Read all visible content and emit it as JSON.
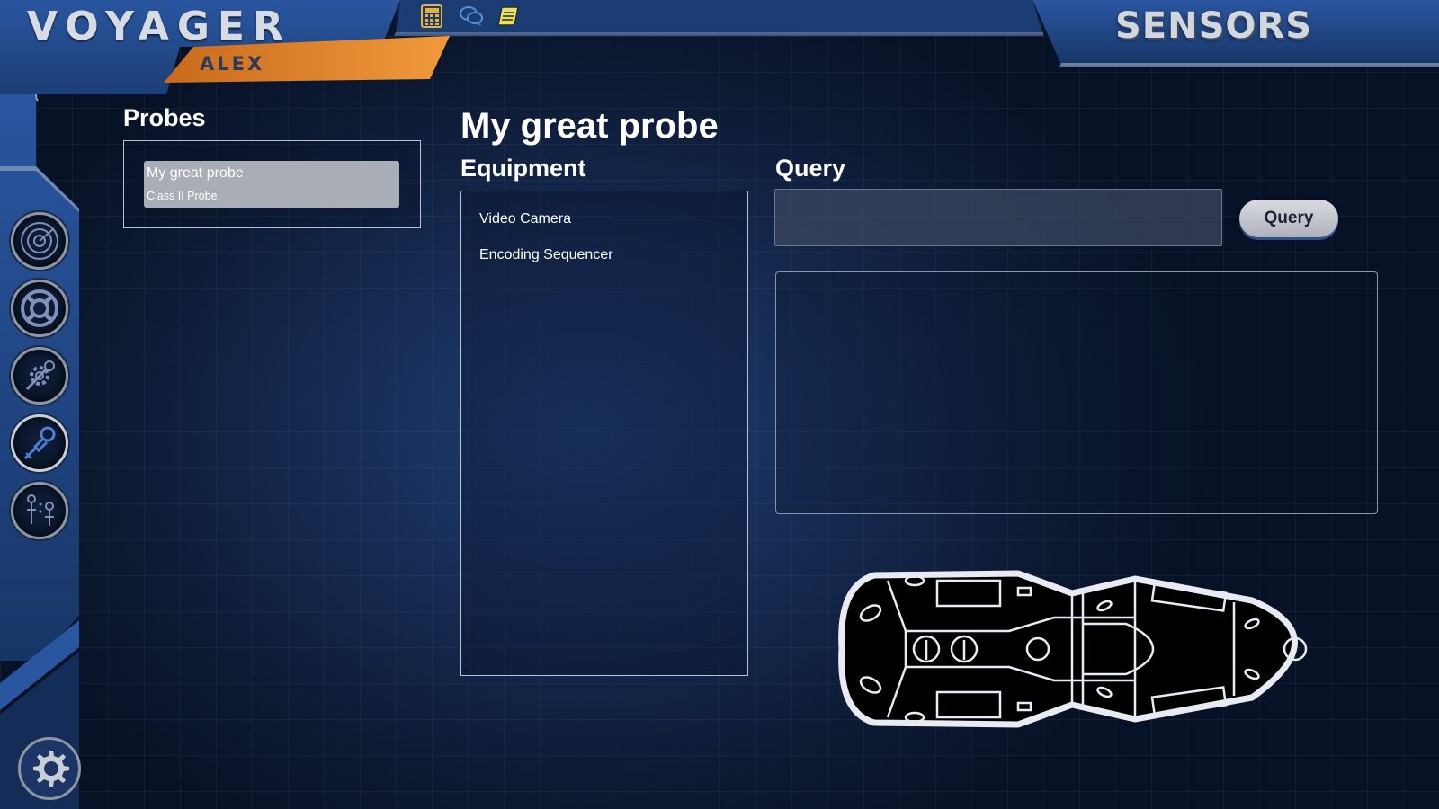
{
  "header": {
    "app_title": "VOYAGER",
    "user_name": "ALEX",
    "station_title": "SENSORS",
    "top_icons": [
      {
        "name": "calculator-icon",
        "color": "#e8b23a"
      },
      {
        "name": "chat-icon",
        "color": "#5a8fd6"
      },
      {
        "name": "notebook-icon",
        "color": "#f0e24a"
      }
    ]
  },
  "sidebar": {
    "nav_buttons": [
      {
        "name": "radar-icon",
        "active": false
      },
      {
        "name": "life-ring-icon",
        "active": false
      },
      {
        "name": "probe-gear-icon",
        "active": false
      },
      {
        "name": "probe-icon",
        "active": true
      },
      {
        "name": "probe-network-icon",
        "active": false
      }
    ],
    "settings_icon": "gear-icon"
  },
  "probes": {
    "label": "Probes",
    "items": [
      {
        "name": "My great probe",
        "class": "Class II Probe",
        "selected": true
      }
    ]
  },
  "main": {
    "probe_title": "My great probe",
    "equipment": {
      "label": "Equipment",
      "items": [
        "Video Camera",
        "Encoding Sequencer"
      ]
    },
    "query": {
      "label": "Query",
      "input_value": "",
      "button_label": "Query",
      "results": ""
    }
  },
  "colors": {
    "accent_orange": "#e88a2a",
    "frame_blue": "#234a8f",
    "background": "#0d1a33"
  }
}
